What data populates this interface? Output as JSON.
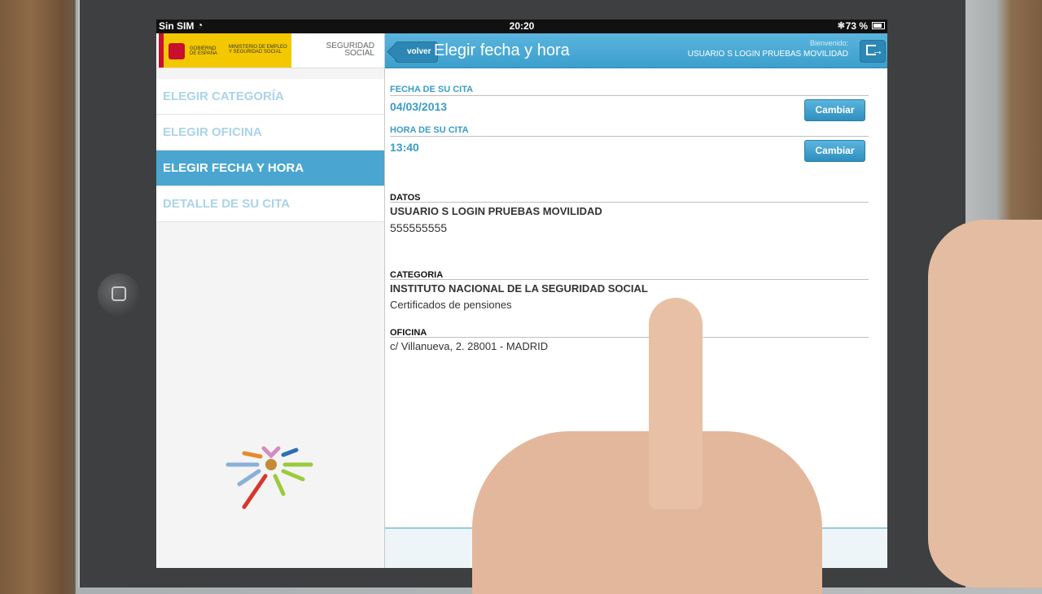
{
  "status_bar": {
    "carrier": "Sin SIM",
    "time": "20:20",
    "battery": "73 %"
  },
  "header_logos": {
    "gobierno": "GOBIERNO DE ESPAÑA",
    "ministerio": "MINISTERIO DE EMPLEO Y SEGURIDAD SOCIAL",
    "seguridad_social": "SEGURIDAD SOCIAL"
  },
  "menu": {
    "items": [
      {
        "label": "ELEGIR CATEGORÍA"
      },
      {
        "label": "ELEGIR OFICINA"
      },
      {
        "label": "ELEGIR FECHA Y HORA"
      },
      {
        "label": "DETALLE DE SU CITA"
      }
    ],
    "active_index": 2
  },
  "nav": {
    "back_label": "volver",
    "title": "Elegir fecha y hora",
    "welcome": "Bienvenido:",
    "user": "USUARIO S LOGIN PRUEBAS MOVILIDAD"
  },
  "cita": {
    "fecha_label": "FECHA DE SU CITA",
    "fecha_value": "04/03/2013",
    "hora_label": "HORA DE SU CITA",
    "hora_value": "13:40",
    "change_label": "Cambiar"
  },
  "datos": {
    "label": "DATOS",
    "name": "USUARIO S LOGIN PRUEBAS MOVILIDAD",
    "phone": "555555555"
  },
  "categoria": {
    "label": "CATEGORIA",
    "name": "INSTITUTO NACIONAL DE LA SEGURIDAD SOCIAL",
    "detail": "Certificados de pensiones"
  },
  "oficina": {
    "label": "OFICINA",
    "address": "c/ Villanueva, 2. 28001 - MADRID"
  },
  "colors": {
    "accent": "#3a9cc9",
    "active_menu": "#4aa6d0",
    "inactive_menu_text": "#a9d4e9"
  }
}
